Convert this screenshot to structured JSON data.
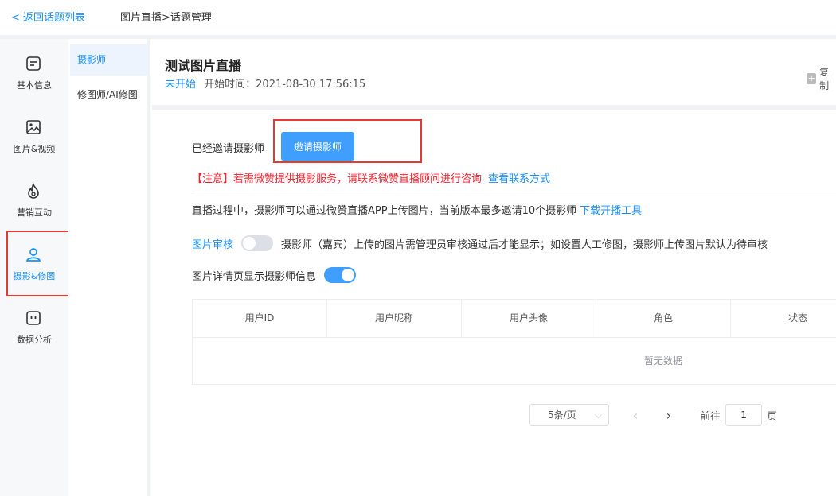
{
  "topbar": {
    "back_label": "< 返回话题列表",
    "breadcrumb": "图片直播>话题管理"
  },
  "leftnav": {
    "items": [
      {
        "label": "基本信息",
        "icon": "document-icon"
      },
      {
        "label": "图片&视频",
        "icon": "image-icon"
      },
      {
        "label": "营销互动",
        "icon": "flame-icon"
      },
      {
        "label": "摄影&修图",
        "icon": "user-icon",
        "active": true
      },
      {
        "label": "数据分析",
        "icon": "chart-icon"
      }
    ]
  },
  "subnav": {
    "items": [
      {
        "label": "摄影师",
        "active": true
      },
      {
        "label": "修图师/AI修图"
      }
    ]
  },
  "header": {
    "title": "测试图片直播",
    "status": "未开始",
    "start_time": "开始时间：2021-08-30 17:56:15",
    "copy_label": "复制"
  },
  "main": {
    "invited_label": "已经邀请摄影师",
    "invite_button": "邀请摄影师",
    "notice": "【注意】若需微赞提供摄影服务，请联系微赞直播顾问进行咨询",
    "contact_link": "查看联系方式",
    "description": "直播过程中，摄影师可以通过微赞直播APP上传图片，当前版本最多邀请10个摄影师",
    "download_link": "下载开播工具",
    "review_label": "图片审核",
    "review_enabled": false,
    "review_desc": "摄影师（嘉宾）上传的图片需管理员审核通过后才能显示；如设置人工修图，摄影师上传图片默认为待审核",
    "show_info_label": "图片详情页显示摄影师信息",
    "show_info_enabled": true
  },
  "table": {
    "columns": [
      "用户ID",
      "用户昵称",
      "用户头像",
      "角色",
      "状态"
    ],
    "empty_text": "暂无数据"
  },
  "pager": {
    "page_size": "5条/页",
    "goto_label": "前往",
    "page_value": "1",
    "page_suffix": "页"
  },
  "colors": {
    "accent": "#1890ff",
    "button": "#409eff",
    "warning": "#f5222d",
    "highlight_box": "#e53935"
  }
}
